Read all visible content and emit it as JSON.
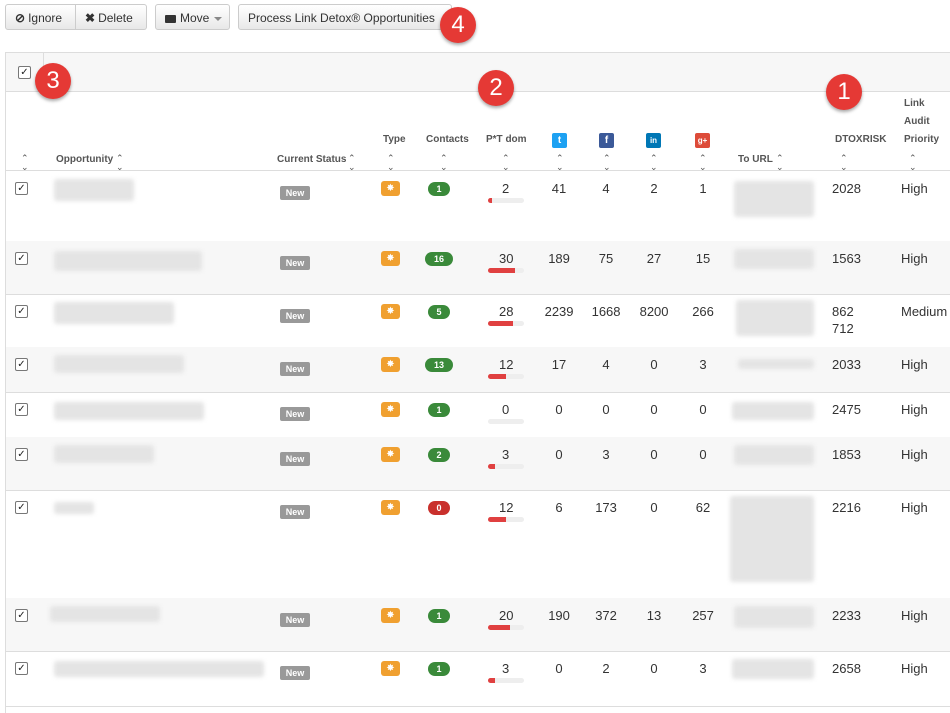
{
  "toolbar": {
    "ignore_label": "Ignore",
    "delete_label": "Delete",
    "move_label": "Move",
    "process_label": "Process Link Detox® Opportunities"
  },
  "markers": [
    "1",
    "2",
    "3",
    "4"
  ],
  "header": {
    "opportunity": "Opportunity",
    "current_status": "Current Status",
    "type": "Type",
    "contacts": "Contacts",
    "ptdom": "P*T dom",
    "to_url": "To URL",
    "dtoxrisk": "DTOXRISK",
    "lap_1": "Link",
    "lap_2": "Audit",
    "lap_3": "Priority",
    "twitter_glyph": "t",
    "facebook_glyph": "f",
    "linkedin_glyph": "in",
    "google_glyph": "g+"
  },
  "colors": {
    "contacts_green": "#3a8a3a",
    "contacts_red": "#c9302c",
    "twitter": "#1da1f2",
    "facebook": "#3b5998",
    "linkedin": "#0077b5",
    "google": "#dd4b39",
    "type_badge": "#f0a030",
    "marker": "#e53935"
  },
  "rows": [
    {
      "status": "New",
      "contacts": "1",
      "ptdom": "2",
      "ptdom_pct": 10,
      "twitter": "41",
      "facebook": "4",
      "linkedin": "2",
      "google": "1",
      "dtoxrisk": "2028",
      "dtoxrisk2": "",
      "priority": "High"
    },
    {
      "status": "New",
      "contacts": "16",
      "ptdom": "30",
      "ptdom_pct": 75,
      "twitter": "189",
      "facebook": "75",
      "linkedin": "27",
      "google": "15",
      "dtoxrisk": "1563",
      "dtoxrisk2": "",
      "priority": "High"
    },
    {
      "status": "New",
      "contacts": "5",
      "ptdom": "28",
      "ptdom_pct": 70,
      "twitter": "2239",
      "facebook": "1668",
      "linkedin": "8200",
      "google": "266",
      "dtoxrisk": "862",
      "dtoxrisk2": "712",
      "priority": "Medium"
    },
    {
      "status": "New",
      "contacts": "13",
      "ptdom": "12",
      "ptdom_pct": 50,
      "twitter": "17",
      "facebook": "4",
      "linkedin": "0",
      "google": "3",
      "dtoxrisk": "2033",
      "dtoxrisk2": "",
      "priority": "High"
    },
    {
      "status": "New",
      "contacts": "1",
      "ptdom": "0",
      "ptdom_pct": 0,
      "twitter": "0",
      "facebook": "0",
      "linkedin": "0",
      "google": "0",
      "dtoxrisk": "2475",
      "dtoxrisk2": "",
      "priority": "High"
    },
    {
      "status": "New",
      "contacts": "2",
      "ptdom": "3",
      "ptdom_pct": 20,
      "twitter": "0",
      "facebook": "3",
      "linkedin": "0",
      "google": "0",
      "dtoxrisk": "1853",
      "dtoxrisk2": "",
      "priority": "High"
    },
    {
      "status": "New",
      "contacts": "0",
      "ptdom": "12",
      "ptdom_pct": 50,
      "twitter": "6",
      "facebook": "173",
      "linkedin": "0",
      "google": "62",
      "dtoxrisk": "2216",
      "dtoxrisk2": "",
      "priority": "High"
    },
    {
      "status": "New",
      "contacts": "1",
      "ptdom": "20",
      "ptdom_pct": 60,
      "twitter": "190",
      "facebook": "372",
      "linkedin": "13",
      "google": "257",
      "dtoxrisk": "2233",
      "dtoxrisk2": "",
      "priority": "High"
    },
    {
      "status": "New",
      "contacts": "1",
      "ptdom": "3",
      "ptdom_pct": 20,
      "twitter": "0",
      "facebook": "2",
      "linkedin": "0",
      "google": "3",
      "dtoxrisk": "2658",
      "dtoxrisk2": "",
      "priority": "High"
    }
  ]
}
